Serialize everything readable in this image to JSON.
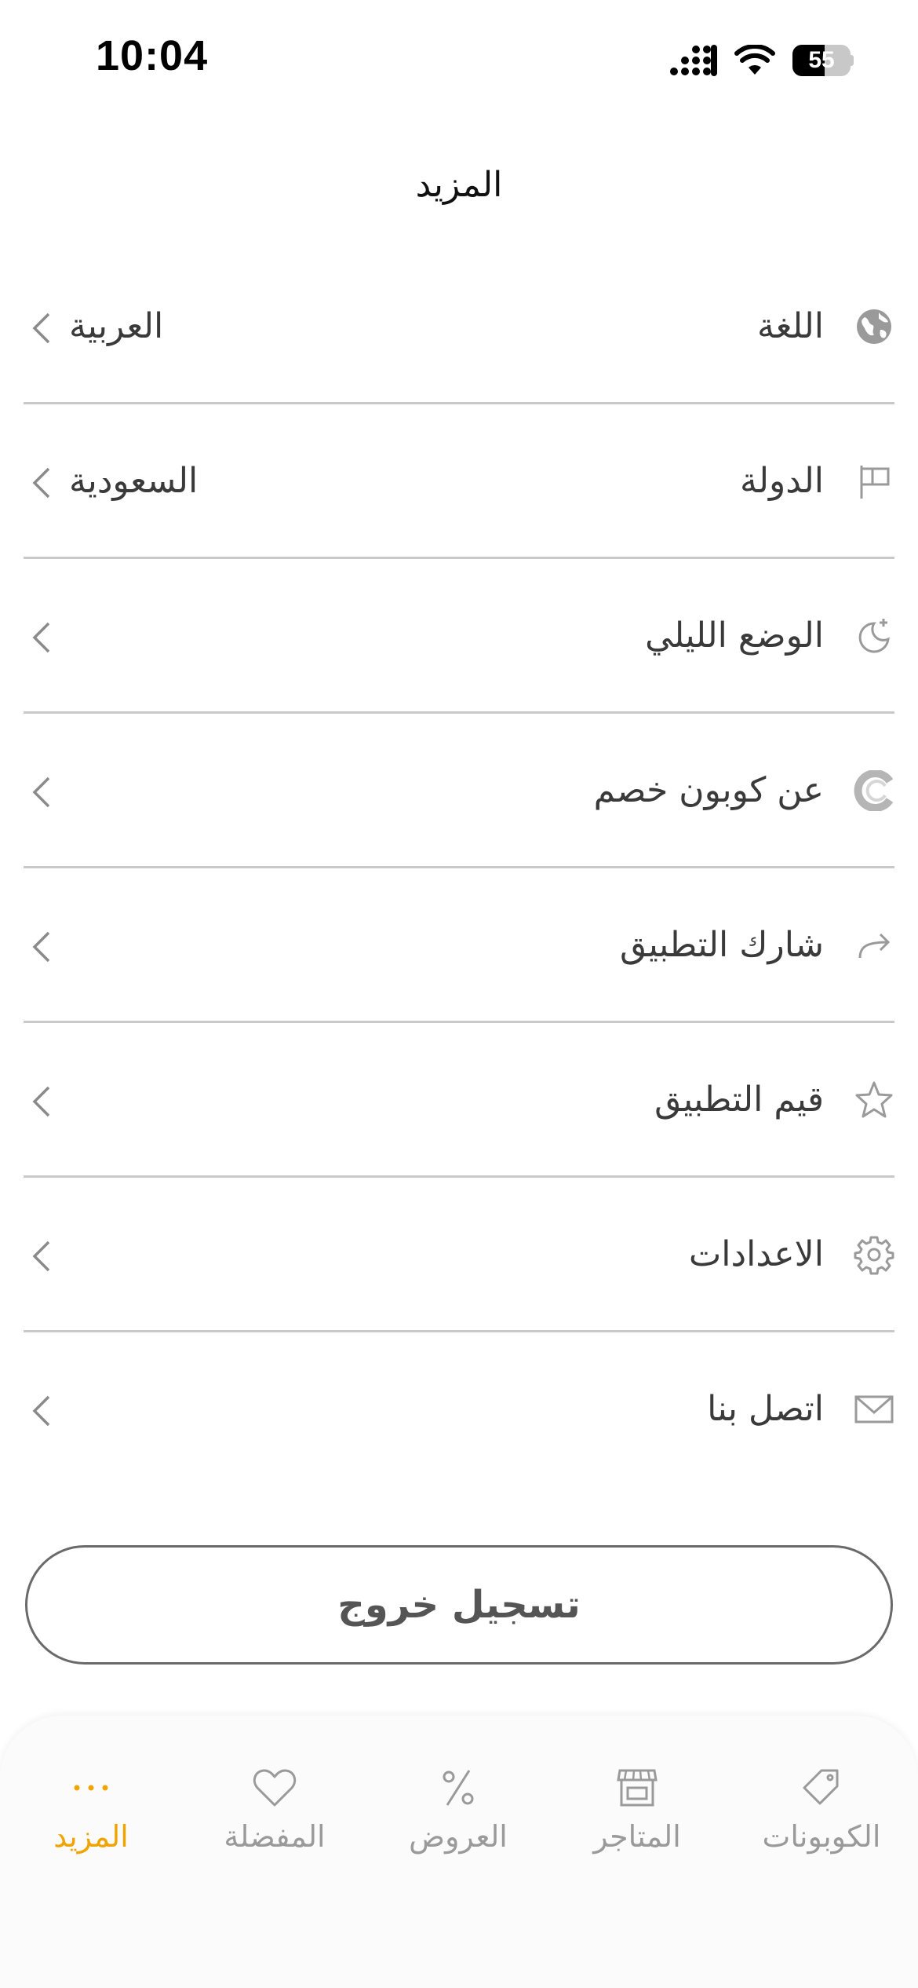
{
  "status_bar": {
    "time": "10:04",
    "battery_percent": "55",
    "battery_level": 0.55
  },
  "header": {
    "title": "المزيد"
  },
  "menu": {
    "items": [
      {
        "label": "اللغة",
        "value": "العربية",
        "icon": "globe-icon"
      },
      {
        "label": "الدولة",
        "value": "السعودية",
        "icon": "flag-icon"
      },
      {
        "label": "الوضع الليلي",
        "value": "",
        "icon": "moon-icon"
      },
      {
        "label": "عن كوبون خصم",
        "value": "",
        "icon": "logo-icon"
      },
      {
        "label": "شارك التطبيق",
        "value": "",
        "icon": "share-icon"
      },
      {
        "label": "قيم التطبيق",
        "value": "",
        "icon": "star-icon"
      },
      {
        "label": "الاعدادات",
        "value": "",
        "icon": "gear-icon"
      },
      {
        "label": "اتصل بنا",
        "value": "",
        "icon": "mail-icon"
      }
    ]
  },
  "logout": {
    "label": "تسجيل خروج"
  },
  "tab_bar": {
    "tabs": [
      {
        "label": "الكوبونات",
        "icon": "tag-icon",
        "active": false
      },
      {
        "label": "المتاجر",
        "icon": "store-icon",
        "active": false
      },
      {
        "label": "العروض",
        "icon": "percent-icon",
        "active": false
      },
      {
        "label": "المفضلة",
        "icon": "heart-icon",
        "active": false
      },
      {
        "label": "المزيد",
        "icon": "more-dots-icon",
        "active": true
      }
    ]
  },
  "colors": {
    "accent": "#f0a400",
    "text": "#3a3a3a",
    "icon_gray": "#9a9a9a",
    "divider": "#c9c9c9"
  }
}
